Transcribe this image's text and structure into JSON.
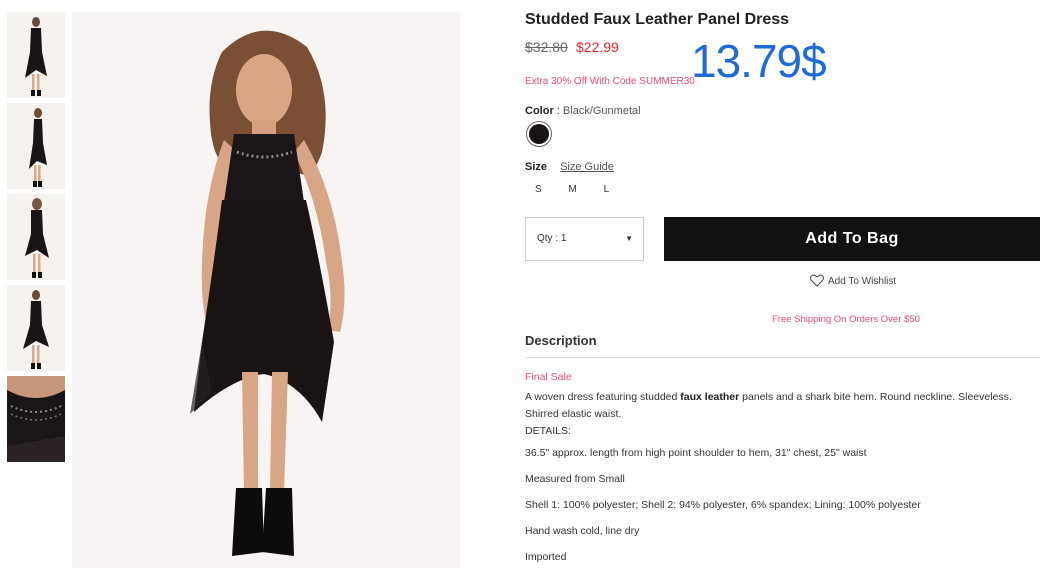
{
  "product": {
    "title": "Studded Faux Leather Panel Dress",
    "price_original": "$32.80",
    "price_sale": "$22.99",
    "promo": "Extra 30% Off With Code SUMMER30",
    "overlay_price": "13.79$"
  },
  "color": {
    "label": "Color",
    "separator": ":",
    "value": "Black/Gunmetal",
    "swatch_color": "#1b1416"
  },
  "size": {
    "label": "Size",
    "guide_link": "Size Guide",
    "options": [
      "S",
      "M",
      "L"
    ]
  },
  "purchase": {
    "qty_label": "Qty : 1",
    "add_to_bag": "Add To Bag",
    "wishlist": "Add To Wishlist",
    "free_shipping": "Free Shipping On Orders Over $50"
  },
  "description": {
    "heading": "Description",
    "final_sale": "Final Sale",
    "text_before": "A woven dress featuring studded ",
    "text_bold": "faux leather",
    "text_after": " panels and a shark bite hem. Round neckline. Sleeveless. Shirred elastic waist.",
    "details_label": "DETAILS:",
    "details": [
      "36.5\" approx. length from high point shoulder to hem, 31\" chest, 25\" waist",
      "Measured from Small",
      "Shell 1: 100% polyester; Shell 2: 94% polyester, 6% spandex; Lining: 100% polyester",
      "Hand wash cold, line dry",
      "Imported"
    ]
  },
  "colors": {
    "sale_red": "#e0252c",
    "promo_pink": "#e84a7b",
    "overlay_blue": "#1f6bd6",
    "button_black": "#111111"
  }
}
